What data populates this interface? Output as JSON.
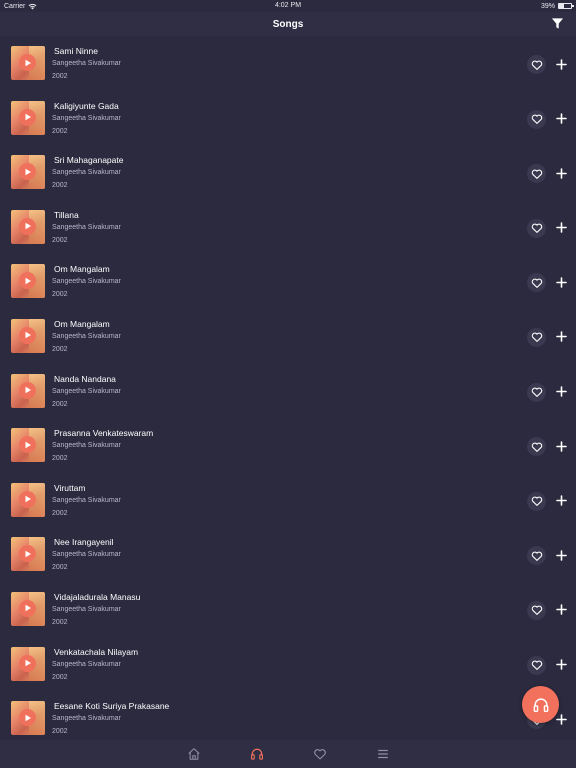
{
  "status_bar": {
    "carrier": "Carrier",
    "time": "4:02 PM",
    "battery": "39%",
    "battery_level": 0.39
  },
  "header": {
    "title": "Songs"
  },
  "songs": [
    {
      "title": "Sami Ninne",
      "artist": "Sangeetha Sivakumar",
      "year": "2002"
    },
    {
      "title": "Kaligiyunte Gada",
      "artist": "Sangeetha Sivakumar",
      "year": "2002"
    },
    {
      "title": "Sri Mahaganapate",
      "artist": "Sangeetha Sivakumar",
      "year": "2002"
    },
    {
      "title": "Tillana",
      "artist": "Sangeetha Sivakumar",
      "year": "2002"
    },
    {
      "title": "Om Mangalam",
      "artist": "Sangeetha Sivakumar",
      "year": "2002"
    },
    {
      "title": "Om Mangalam",
      "artist": "Sangeetha Sivakumar",
      "year": "2002"
    },
    {
      "title": "Nanda Nandana",
      "artist": "Sangeetha Sivakumar",
      "year": "2002"
    },
    {
      "title": "Prasanna Venkateswaram",
      "artist": "Sangeetha Sivakumar",
      "year": "2002"
    },
    {
      "title": "Viruttam",
      "artist": "Sangeetha Sivakumar",
      "year": "2002"
    },
    {
      "title": "Nee Irangayenil",
      "artist": "Sangeetha Sivakumar",
      "year": "2002"
    },
    {
      "title": "Vidajaladurala Manasu",
      "artist": "Sangeetha Sivakumar",
      "year": "2002"
    },
    {
      "title": "Venkatachala Nilayam",
      "artist": "Sangeetha Sivakumar",
      "year": "2002"
    },
    {
      "title": "Eesane Koti Suriya Prakasane",
      "artist": "Sangeetha Sivakumar",
      "year": "2002"
    }
  ],
  "icons": {
    "filter": "filter-icon",
    "play": "play-icon",
    "like": "heart-icon",
    "add": "plus-icon",
    "now_playing": "headphones-icon",
    "tabs": [
      "home-icon",
      "headphones-icon",
      "heart-icon",
      "menu-icon"
    ]
  },
  "tabs": {
    "active": "songs"
  },
  "colors": {
    "background": "#2b2a3f",
    "bar": "#2f2e44",
    "accent": "#f2715c",
    "icon_inactive": "#8f8ea3",
    "text_secondary": "#b9b8c8"
  }
}
